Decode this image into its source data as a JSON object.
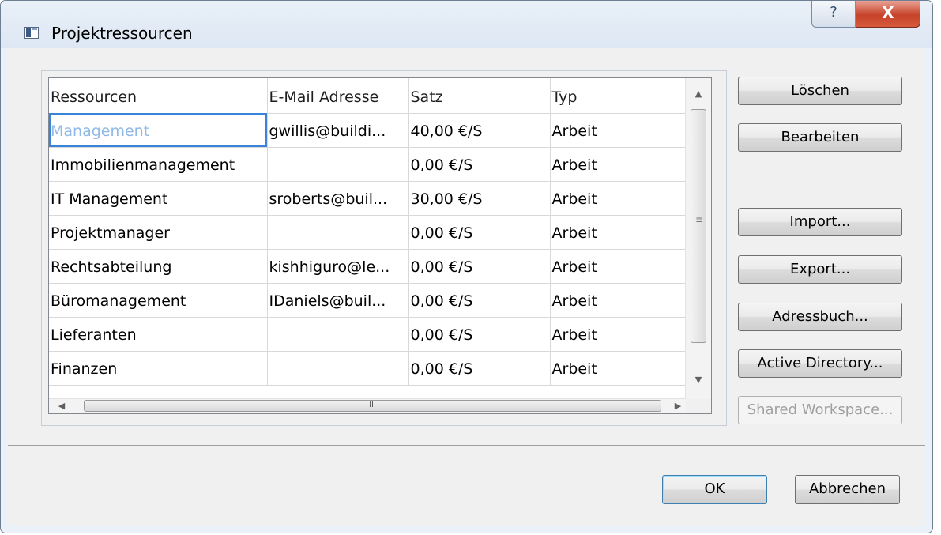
{
  "window": {
    "title": "Projektressourcen",
    "help_label": "?",
    "close_label": "X"
  },
  "grid": {
    "columns": [
      "Ressourcen",
      "E-Mail Adresse",
      "Satz",
      "Typ"
    ],
    "rows": [
      {
        "name": "Management",
        "email": "gwillis@buildi...",
        "rate": "40,00 €/S",
        "type": "Arbeit"
      },
      {
        "name": "Immobilienmanagement",
        "email": "",
        "rate": "0,00 €/S",
        "type": "Arbeit"
      },
      {
        "name": "IT Management",
        "email": "sroberts@buil...",
        "rate": "30,00 €/S",
        "type": "Arbeit"
      },
      {
        "name": "Projektmanager",
        "email": "",
        "rate": "0,00 €/S",
        "type": "Arbeit"
      },
      {
        "name": "Rechtsabteilung",
        "email": "kishhiguro@le...",
        "rate": "0,00 €/S",
        "type": "Arbeit"
      },
      {
        "name": "Büromanagement",
        "email": "IDaniels@buil...",
        "rate": "0,00 €/S",
        "type": "Arbeit"
      },
      {
        "name": "Lieferanten",
        "email": "",
        "rate": "0,00 €/S",
        "type": "Arbeit"
      },
      {
        "name": "Finanzen",
        "email": "",
        "rate": "0,00 €/S",
        "type": "Arbeit"
      }
    ],
    "selected_row": 0,
    "hscroll_grip": "III",
    "vscroll_grip": "≡"
  },
  "side_buttons": {
    "delete": "Löschen",
    "edit": "Bearbeiten",
    "import": "Import...",
    "export": "Export...",
    "address_book": "Adressbuch...",
    "active_directory": "Active Directory...",
    "shared_workspace": "Shared Workspace..."
  },
  "footer": {
    "ok": "OK",
    "cancel": "Abbrechen"
  }
}
